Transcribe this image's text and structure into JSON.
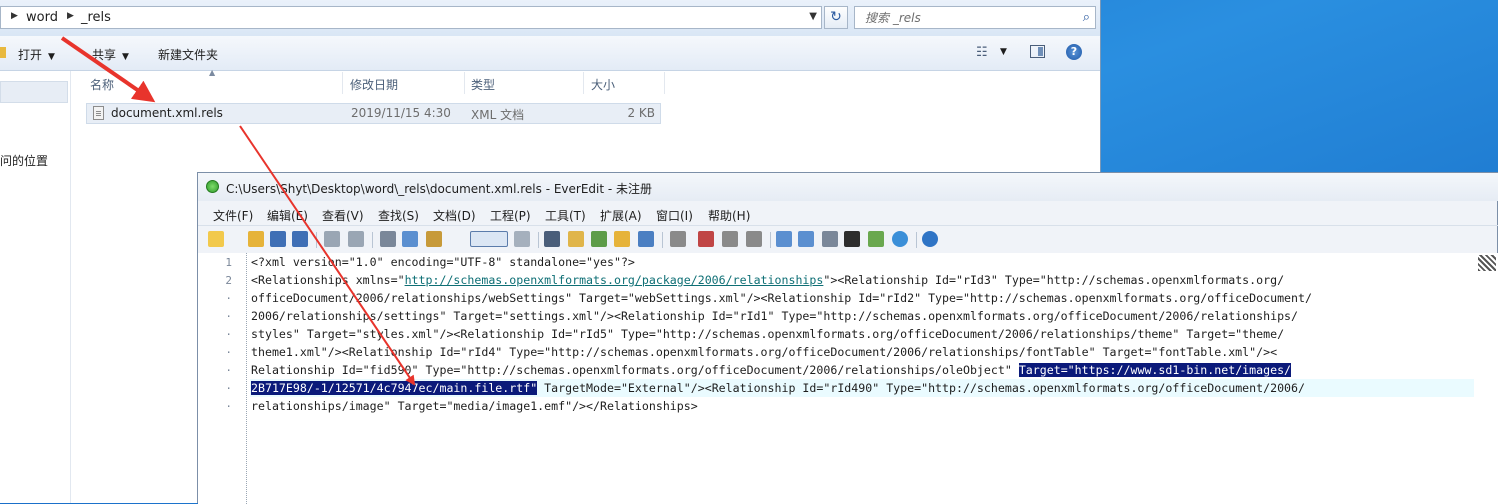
{
  "explorer": {
    "breadcrumb": [
      "word",
      "_rels"
    ],
    "search_placeholder": "搜索 _rels",
    "toolbar": {
      "open": "打开",
      "share": "共享",
      "new_folder": "新建文件夹"
    },
    "nav": {
      "recent": "问的位置"
    },
    "columns": {
      "name": "名称",
      "modified": "修改日期",
      "type": "类型",
      "size": "大小"
    },
    "file": {
      "name": "document.xml.rels",
      "modified": "2019/11/15 4:30",
      "type": "XML 文档",
      "size": "2 KB"
    }
  },
  "editor": {
    "title": "C:\\Users\\Shyt\\Desktop\\word\\_rels\\document.xml.rels - EverEdit - 未注册",
    "menu": [
      "文件(F)",
      "编辑(E)",
      "查看(V)",
      "查找(S)",
      "文档(D)",
      "工程(P)",
      "工具(T)",
      "扩展(A)",
      "窗口(I)",
      "帮助(H)"
    ],
    "gutter": [
      "1",
      "2",
      "·",
      "·",
      "·",
      "·",
      "·",
      "·",
      "·"
    ],
    "lines": {
      "l1": "<?xml version=\"1.0\" encoding=\"UTF-8\" standalone=\"yes\"?>",
      "l2a": "<Relationships xmlns=\"",
      "l2url": "http://schemas.openxmlformats.org/package/2006/relationships",
      "l2b": "\"><Relationship Id=\"rId3\" Type=\"http://schemas.openxmlformats.org/",
      "l3": "officeDocument/2006/relationships/webSettings\" Target=\"webSettings.xml\"/><Relationship Id=\"rId2\" Type=\"http://schemas.openxmlformats.org/officeDocument/",
      "l4": "2006/relationships/settings\" Target=\"settings.xml\"/><Relationship Id=\"rId1\" Type=\"http://schemas.openxmlformats.org/officeDocument/2006/relationships/",
      "l5": "styles\" Target=\"styles.xml\"/><Relationship Id=\"rId5\" Type=\"http://schemas.openxmlformats.org/officeDocument/2006/relationships/theme\" Target=\"theme/",
      "l6": "theme1.xml\"/><Relationship Id=\"rId4\" Type=\"http://schemas.openxmlformats.org/officeDocument/2006/relationships/fontTable\" Target=\"fontTable.xml\"/><",
      "l7a": "Relationship Id=\"fid590\" Type=\"http://schemas.openxmlformats.org/officeDocument/2006/relationships/oleObject\" ",
      "l7sel": "Target=\"https://www.sd1-bin.net/images/",
      "l8sel": "2B717E98/-1/12571/4c7947ec/main.file.rtf\"",
      "l8b": " TargetMode=\"External\"/><Relationship Id=\"rId490\" Type=\"http://schemas.openxmlformats.org/officeDocument/2006/",
      "l9": "relationships/image\" Target=\"media/image1.emf\"/></Relationships>"
    }
  },
  "colors": {
    "arrow": "#e8342c",
    "selection": "#0b1a7a",
    "link": "#0e6f75",
    "current_line": "#eafbff"
  },
  "icons": [
    "search-icon",
    "refresh-icon",
    "help-icon",
    "view-icon",
    "preview-pane-icon",
    "file-icon",
    "everedit-logo-icon"
  ]
}
